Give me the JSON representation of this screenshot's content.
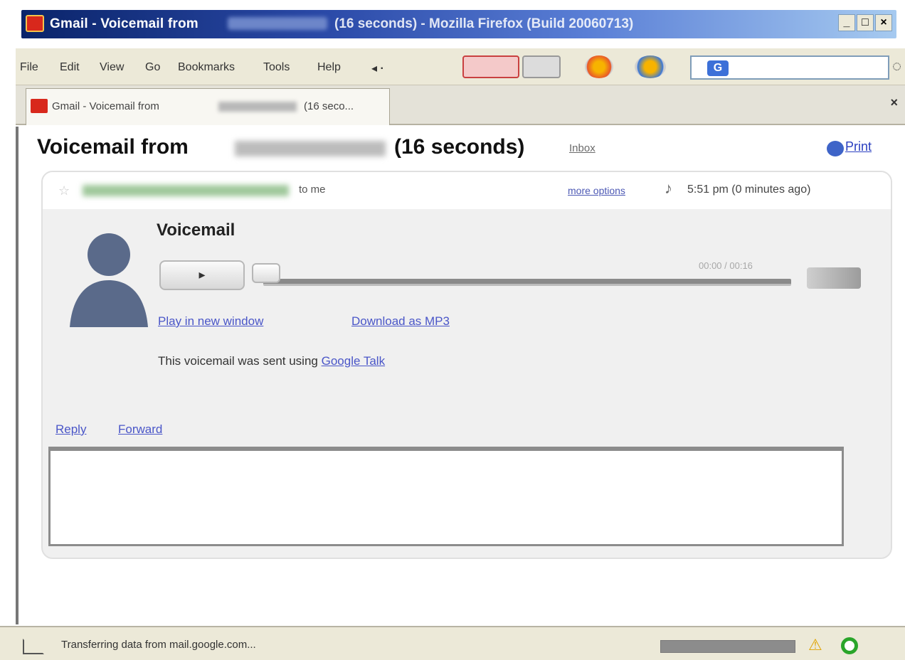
{
  "window": {
    "title_prefix": "Gmail - Voicemail from",
    "title_suffix": "(16 seconds) - Mozilla Firefox (Build 20060713)",
    "minimize": "_",
    "maximize": "□",
    "close": "×"
  },
  "menu": {
    "items": [
      "File",
      "Edit",
      "View",
      "Go",
      "Bookmarks",
      "Tools",
      "Help"
    ],
    "search_engine_glyph": "G"
  },
  "tab": {
    "label": "Gmail - Voicemail from",
    "suffix": "(16 seco...",
    "close": "×"
  },
  "email": {
    "subject_prefix": "Voicemail from",
    "subject_suffix": "(16 seconds)",
    "label": "Inbox",
    "print": "Print",
    "to": "to me",
    "more_options": "more options",
    "time": "5:51 pm (0 minutes ago)",
    "star": "☆",
    "attach": "♪"
  },
  "voicemail": {
    "title": "Voicemail",
    "play": "▸",
    "time_display": "00:00 / 00:16",
    "play_new_window": "Play in new window",
    "download_mp3": "Download as MP3",
    "sent_using_prefix": "This voicemail was sent using",
    "sent_using_link": "Google Talk"
  },
  "actions": {
    "reply": "Reply",
    "forward": "Forward"
  },
  "status": {
    "text": "Transferring data from mail.google.com...",
    "warning": "⚠"
  },
  "colors": {
    "title_bar": "#0a246a",
    "link": "#4a56c8",
    "brand_red": "#d8281c"
  }
}
